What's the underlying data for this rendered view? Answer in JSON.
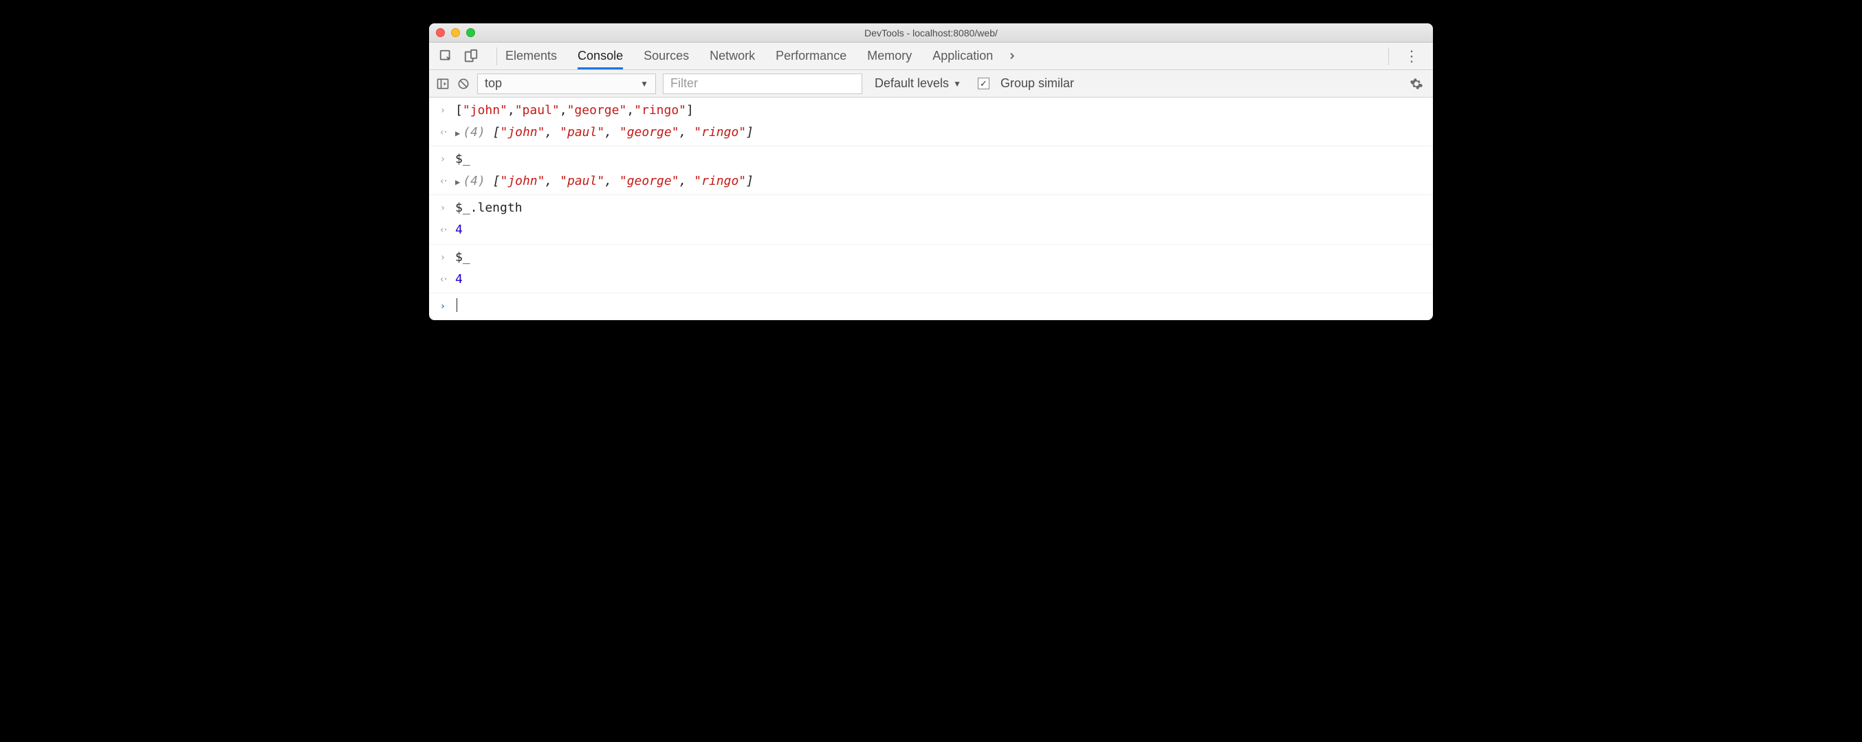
{
  "window": {
    "title": "DevTools - localhost:8080/web/"
  },
  "tabs": {
    "items": [
      "Elements",
      "Console",
      "Sources",
      "Network",
      "Performance",
      "Memory",
      "Application"
    ],
    "active_index": 1
  },
  "filter_bar": {
    "context": "top",
    "filter_placeholder": "Filter",
    "filter_value": "",
    "levels_label": "Default levels",
    "group_similar_label": "Group similar",
    "group_similar_checked": true
  },
  "console_rows": [
    {
      "kind": "input",
      "tokens": [
        {
          "t": "[",
          "c": "punc"
        },
        {
          "t": "\"john\"",
          "c": "str"
        },
        {
          "t": ",",
          "c": "punc"
        },
        {
          "t": "\"paul\"",
          "c": "str"
        },
        {
          "t": ",",
          "c": "punc"
        },
        {
          "t": "\"george\"",
          "c": "str"
        },
        {
          "t": ",",
          "c": "punc"
        },
        {
          "t": "\"ringo\"",
          "c": "str"
        },
        {
          "t": "]",
          "c": "punc"
        }
      ]
    },
    {
      "kind": "output",
      "expandable": true,
      "tokens": [
        {
          "t": "(4) ",
          "c": "meta"
        },
        {
          "t": "[",
          "c": "punc-i"
        },
        {
          "t": "\"john\"",
          "c": "arr"
        },
        {
          "t": ", ",
          "c": "punc-i"
        },
        {
          "t": "\"paul\"",
          "c": "arr"
        },
        {
          "t": ", ",
          "c": "punc-i"
        },
        {
          "t": "\"george\"",
          "c": "arr"
        },
        {
          "t": ", ",
          "c": "punc-i"
        },
        {
          "t": "\"ringo\"",
          "c": "arr"
        },
        {
          "t": "]",
          "c": "punc-i"
        }
      ]
    },
    {
      "kind": "input",
      "tokens": [
        {
          "t": "$_",
          "c": "plain"
        }
      ]
    },
    {
      "kind": "output",
      "expandable": true,
      "tokens": [
        {
          "t": "(4) ",
          "c": "meta"
        },
        {
          "t": "[",
          "c": "punc-i"
        },
        {
          "t": "\"john\"",
          "c": "arr"
        },
        {
          "t": ", ",
          "c": "punc-i"
        },
        {
          "t": "\"paul\"",
          "c": "arr"
        },
        {
          "t": ", ",
          "c": "punc-i"
        },
        {
          "t": "\"george\"",
          "c": "arr"
        },
        {
          "t": ", ",
          "c": "punc-i"
        },
        {
          "t": "\"ringo\"",
          "c": "arr"
        },
        {
          "t": "]",
          "c": "punc-i"
        }
      ]
    },
    {
      "kind": "input",
      "tokens": [
        {
          "t": "$_.length",
          "c": "plain"
        }
      ]
    },
    {
      "kind": "output",
      "tokens": [
        {
          "t": "4",
          "c": "num"
        }
      ]
    },
    {
      "kind": "input",
      "tokens": [
        {
          "t": "$_",
          "c": "plain"
        }
      ]
    },
    {
      "kind": "output",
      "tokens": [
        {
          "t": "4",
          "c": "num"
        }
      ]
    },
    {
      "kind": "prompt"
    }
  ]
}
